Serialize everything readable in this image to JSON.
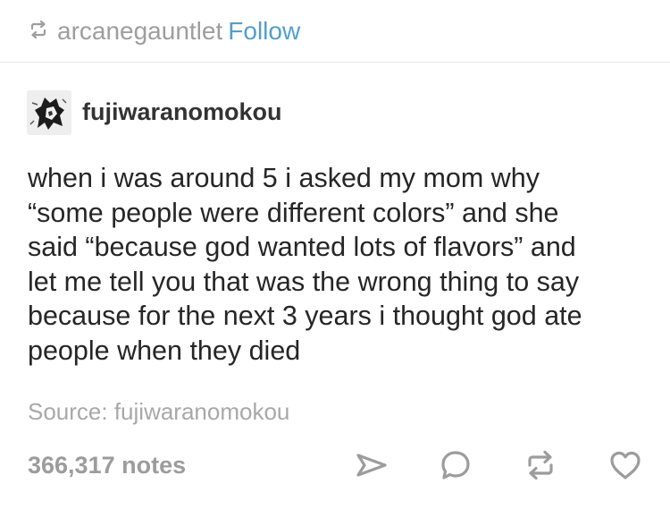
{
  "header": {
    "reblogger": "arcanegauntlet",
    "follow_label": "Follow",
    "icon": "reblog-icon"
  },
  "post": {
    "author": "fujiwaranomokou",
    "avatar_icon": "avatar-image",
    "body_lines": [
      "when i was around 5 i asked my mom why",
      "“some people were different colors” and she",
      "said “because god wanted lots of flavors” and",
      "let me tell you that was the wrong thing to say",
      "because for the next 3 years i thought god ate",
      "people when they died"
    ],
    "source_label": "Source: fujiwaranomokou"
  },
  "footer": {
    "notes": "366,317 notes",
    "actions": [
      "share-icon",
      "reply-icon",
      "reblog-icon",
      "like-icon"
    ]
  },
  "colors": {
    "link_blue": "#529ecc",
    "muted_gray": "#9e9e9e",
    "text": "#262626",
    "icon_gray": "#9c9c9c"
  }
}
